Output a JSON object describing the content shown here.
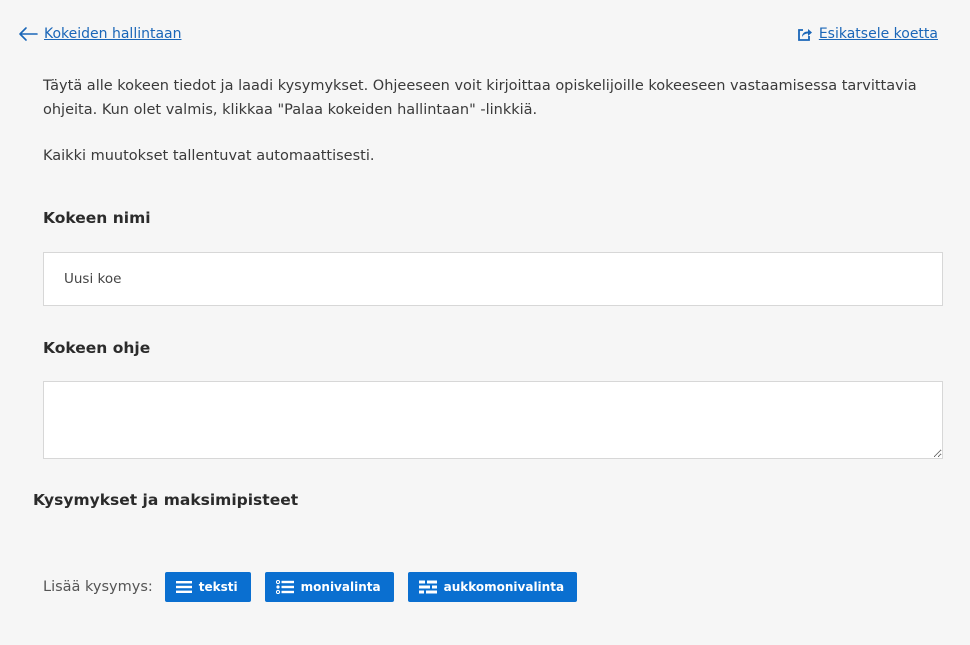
{
  "nav": {
    "back_label": "Kokeiden hallintaan",
    "preview_label": "Esikatsele koetta"
  },
  "intro": {
    "paragraph1": "Täytä alle kokeen tiedot ja laadi kysymykset. Ohjeeseen voit kirjoittaa opiskelijoille kokeeseen vastaamisessa tarvittavia ohjeita. Kun olet valmis, klikkaa \"Palaa kokeiden hallintaan\" -linkkiä.",
    "paragraph2": "Kaikki muutokset tallentuvat automaattisesti."
  },
  "form": {
    "name_label": "Kokeen nimi",
    "name_value": "Uusi koe",
    "instructions_label": "Kokeen ohje",
    "instructions_value": ""
  },
  "questions": {
    "heading": "Kysymykset ja maksimipisteet",
    "add_label": "Lisää kysymys:",
    "buttons": [
      {
        "label": "teksti",
        "icon": "text-lines-icon"
      },
      {
        "label": "monivalinta",
        "icon": "list-choice-icon"
      },
      {
        "label": "aukkomonivalinta",
        "icon": "gap-choice-icon"
      }
    ]
  },
  "colors": {
    "link": "#1a66b8",
    "button": "#0a6fd0",
    "background": "#f6f6f6"
  }
}
